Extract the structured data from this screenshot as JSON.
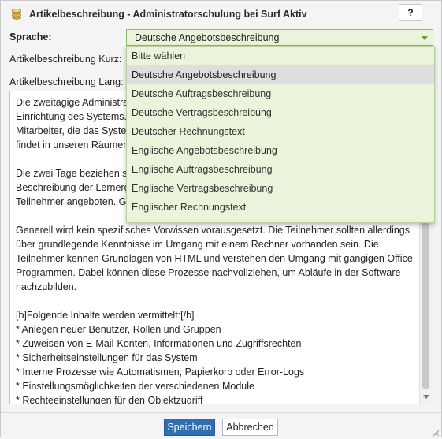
{
  "window": {
    "title": "Artikelbeschreibung - Administratorschulung bei Surf Aktiv",
    "help_label": "?"
  },
  "form": {
    "sprache_label": "Sprache:",
    "kurz_label": "Artikelbeschreibung Kurz:",
    "lang_label": "Artikelbeschreibung Lang:",
    "sprache_value": "Deutsche Angebotsbeschreibung",
    "options": [
      "Bitte wählen",
      "Deutsche Angebotsbeschreibung",
      "Deutsche Auftragsbeschreibung",
      "Deutsche Vertragsbeschreibung",
      "Deutscher Rechnungstext",
      "Englische Angebotsbeschreibung",
      "Englische Auftragsbeschreibung",
      "Englische Vertragsbeschreibung",
      "Englischer Rechnungstext"
    ],
    "lang_text": "Die zweitägige Administratorschulung vermittelt alle wichtigen Grundlagen für die Einrichtung des Systems. Die Schulung richtet sich speziell an Administratoren und Mitarbeiter, die das System verwalten werden (bzw. dies bereits tun). Die Veranstaltung findet in unseren Räumen statt.\n\nDie zwei Tage beziehen sich jeweils auf acht Stunden inklusive Pausen. Eine ausführliche Beschreibung der Lernergebnisse findet die Schulung wird zum Preis von {$PRICE} pro Teilnehmer angeboten. Gebucht wurden {$QUANTITY} Schulungsteilnehmer.\n\nGenerell wird kein spezifisches Vorwissen vorausgesetzt. Die Teilnehmer sollten allerdings über grundlegende Kenntnisse im Umgang mit einem Rechner vorhanden sein. Die Teilnehmer kennen Grundlagen von HTML und verstehen den Umgang mit gängigen Office-Programmen. Dabei können diese Prozesse nachvollziehen, um Abläufe in der Software nachzubilden.\n\n[b]Folgende Inhalte werden vermittelt:[/b]\n* Anlegen neuer Benutzer, Rollen und Gruppen\n* Zuweisen von E-Mail-Konten, Informationen und Zugriffsrechten\n* Sicherheitseinstellungen für das System\n* Interne Prozesse wie Automatismen, Papierkorb oder Error-Logs\n* Einstellungsmöglichkeiten der verschiedenen Module\n* Rechteeinstellungen für den Objektzugriff\n* Rechteeinstellungen für Dokumente und Ordner\n* Arbeiten mit Zugriffslisten"
  },
  "footer": {
    "save_label": "Speichern",
    "cancel_label": "Abbrechen"
  },
  "colors": {
    "select_bg": "#e9f4da",
    "select_border": "#8fb86a",
    "primary_button": "#2e6fb1",
    "hover_option": "#dedede"
  },
  "icons": {
    "title_icon": "coin-stack-icon",
    "resize": "resize-grip-icon"
  }
}
